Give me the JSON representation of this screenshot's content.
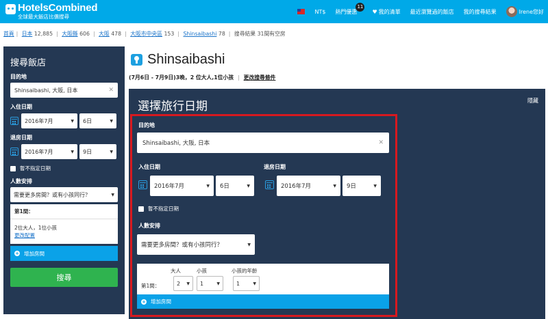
{
  "topbar": {
    "brand": "HotelsCombined",
    "tagline": "全球最大飯店比價搜尋",
    "currency": "NT$",
    "hot_deals": "熱門優惠",
    "hot_deals_count": "11",
    "favorites": "我的清單",
    "recent_viewed": "最近瀏覽過的飯店",
    "my_results": "我的搜尋結果",
    "user_greeting": "Irene您好"
  },
  "breadcrumb": {
    "items": [
      {
        "label": "首頁",
        "count": ""
      },
      {
        "label": "日本",
        "count": "12,885"
      },
      {
        "label": "大阪縣",
        "count": "606"
      },
      {
        "label": "大阪",
        "count": "478"
      },
      {
        "label": "大阪市中央區",
        "count": "153"
      },
      {
        "label": "Shinsaibashi",
        "count": "78"
      }
    ],
    "current": "搜尋結果 31間有空房"
  },
  "sidebar": {
    "title": "搜尋飯店",
    "destination_label": "目的地",
    "destination_value": "Shinsaibashi, 大阪, 日本",
    "checkin_label": "入住日期",
    "checkin_month": "2016年7月",
    "checkin_day": "6日",
    "checkout_label": "退房日期",
    "checkout_month": "2016年7月",
    "checkout_day": "9日",
    "no_dates_label": "暫不指定日期",
    "guests_label": "人數安排",
    "guests_select": "需要更多房間？或有小孩同行？",
    "room_title": "第1間：",
    "room_summary": "2位大人，1位小孩",
    "change_config": "更改配置",
    "add_room": "增加房間",
    "search_button": "搜尋"
  },
  "main": {
    "title": "Shinsaibashi",
    "summary": "(7月6日 - 7月9日)3晚，2 位大人,1位小孩",
    "change_search": "更改搜尋條件"
  },
  "panel": {
    "title": "選擇旅行日期",
    "hide": "隱藏",
    "destination_label": "目的地",
    "destination_value": "Shinsaibashi, 大阪, 日本",
    "checkin_label": "入住日期",
    "checkin_month": "2016年7月",
    "checkin_day": "6日",
    "checkout_label": "退房日期",
    "checkout_month": "2016年7月",
    "checkout_day": "9日",
    "no_dates_label": "暫不指定日期",
    "guests_label": "人數安排",
    "guests_select": "需要更多房間？或有小孩同行？",
    "room_label": "第1間：",
    "adults_label": "大人",
    "children_label": "小孩",
    "child_age_label": "小孩的年齡",
    "adults_value": "2",
    "children_value": "1",
    "child_age_value": "1",
    "add_room": "增加房間"
  },
  "colors": {
    "topbar": "#00a9e8",
    "panel": "#243853",
    "highlight_frame": "#d7191f",
    "search_button": "#2fb34f",
    "add_room": "#0aa2e8"
  }
}
